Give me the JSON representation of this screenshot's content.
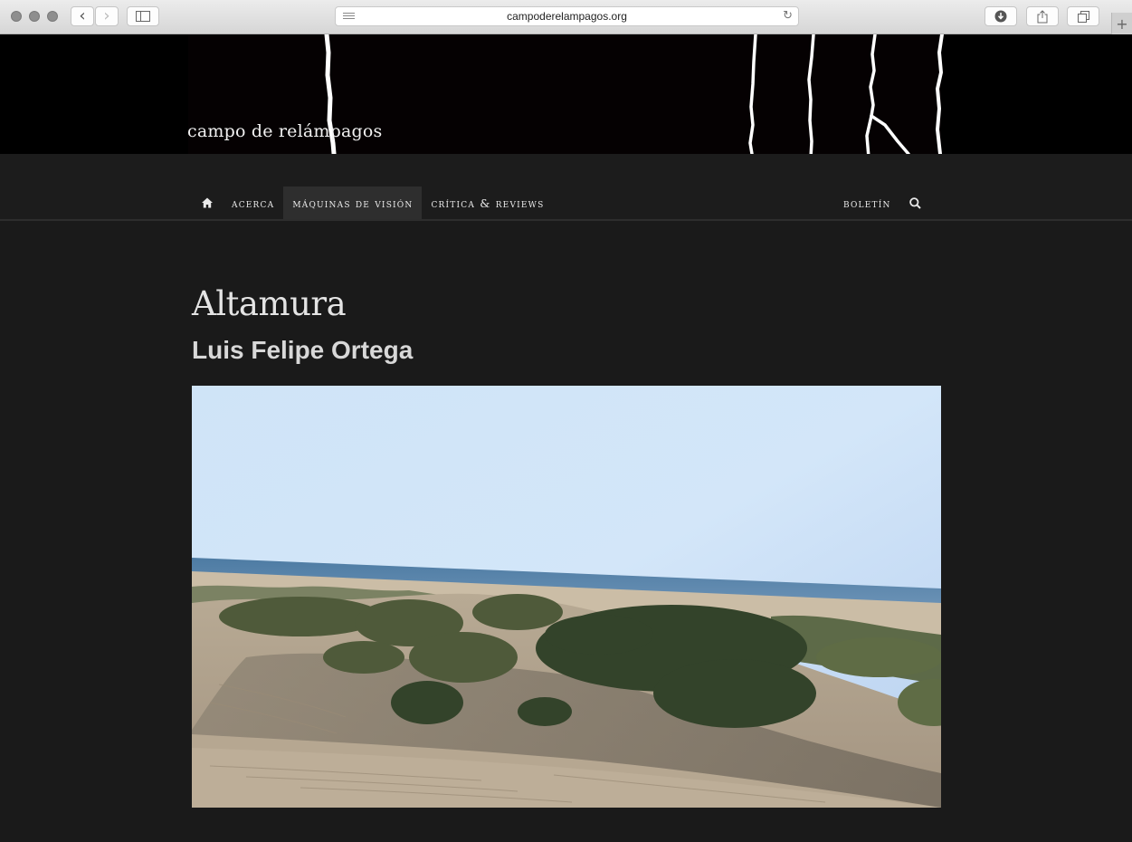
{
  "browser": {
    "url": "campoderelampagos.org",
    "new_tab_glyph": "+",
    "back_glyph": "‹",
    "forward_glyph": "›"
  },
  "site": {
    "title": "campo de relámpagos"
  },
  "nav": {
    "items": [
      {
        "label": "Acerca"
      },
      {
        "label": "Máquinas de visión",
        "active": true
      },
      {
        "label": "Crítica & Reviews"
      }
    ],
    "right": {
      "label": "Boletín"
    }
  },
  "article": {
    "title": "Altamura",
    "subtitle": "Luis Felipe Ortega",
    "image": "sand-dunes-beach-photo"
  },
  "colors": {
    "page_bg": "#1a1a1a",
    "banner_bg": "#000000",
    "nav_active_bg": "#2e2e2e",
    "text": "#e4e4e4"
  }
}
